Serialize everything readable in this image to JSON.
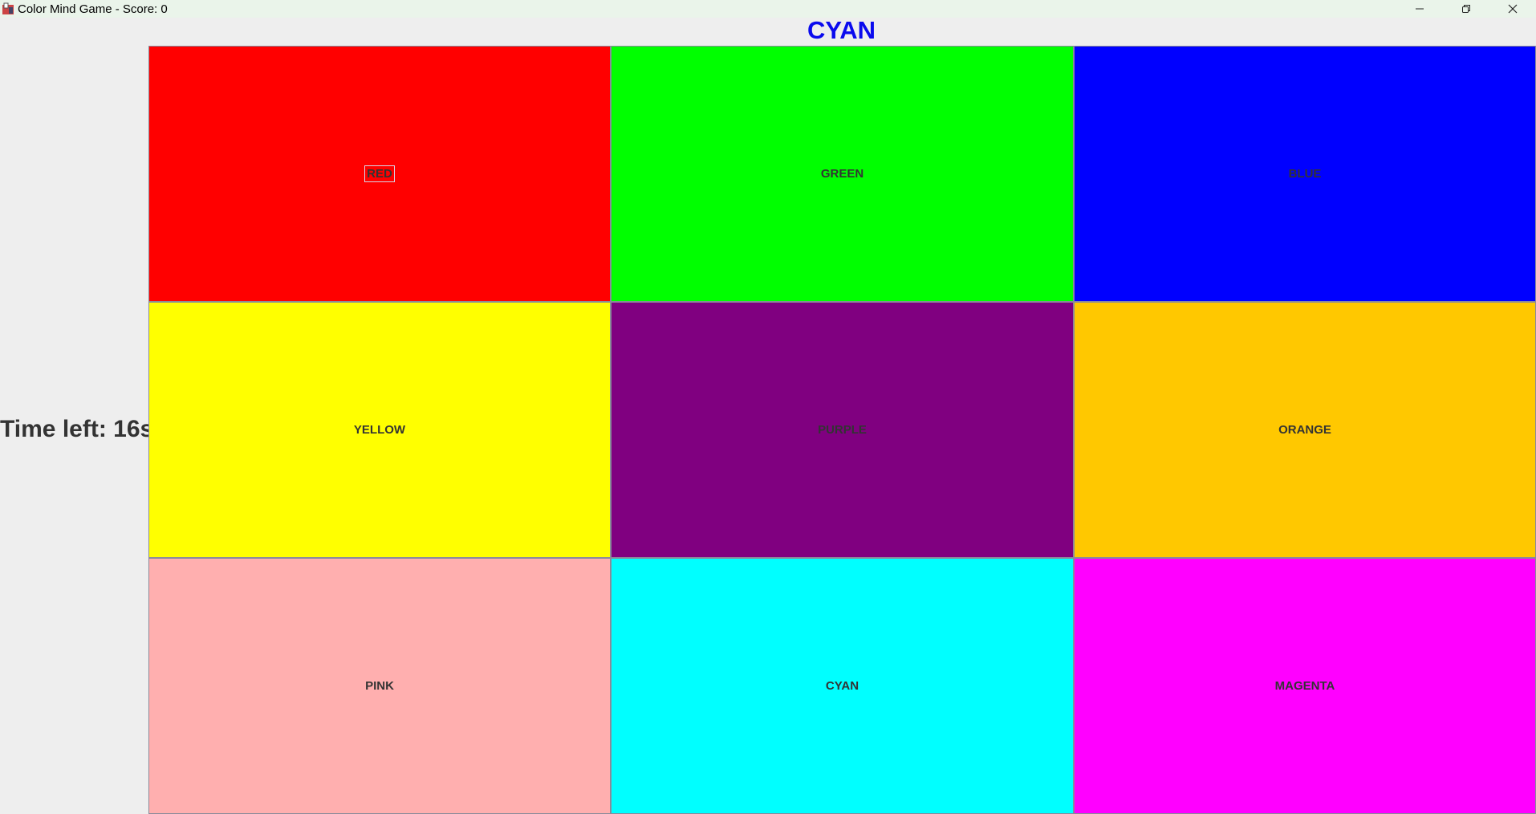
{
  "window": {
    "title": "Color Mind Game - Score: 0",
    "controls": [
      "minimize-icon",
      "restore-icon",
      "close-icon"
    ]
  },
  "game": {
    "target_word": "CYAN",
    "target_word_color": "#0a0aee",
    "timer_text": "Time left: 16s",
    "focused_tile": "RED"
  },
  "tiles": [
    {
      "label": "RED",
      "color": "#ff0000"
    },
    {
      "label": "GREEN",
      "color": "#00ff00"
    },
    {
      "label": "BLUE",
      "color": "#0000ff"
    },
    {
      "label": "YELLOW",
      "color": "#ffff00"
    },
    {
      "label": "PURPLE",
      "color": "#800080"
    },
    {
      "label": "ORANGE",
      "color": "#ffc800"
    },
    {
      "label": "PINK",
      "color": "#ffafaf"
    },
    {
      "label": "CYAN",
      "color": "#00ffff"
    },
    {
      "label": "MAGENTA",
      "color": "#ff00ff"
    }
  ]
}
